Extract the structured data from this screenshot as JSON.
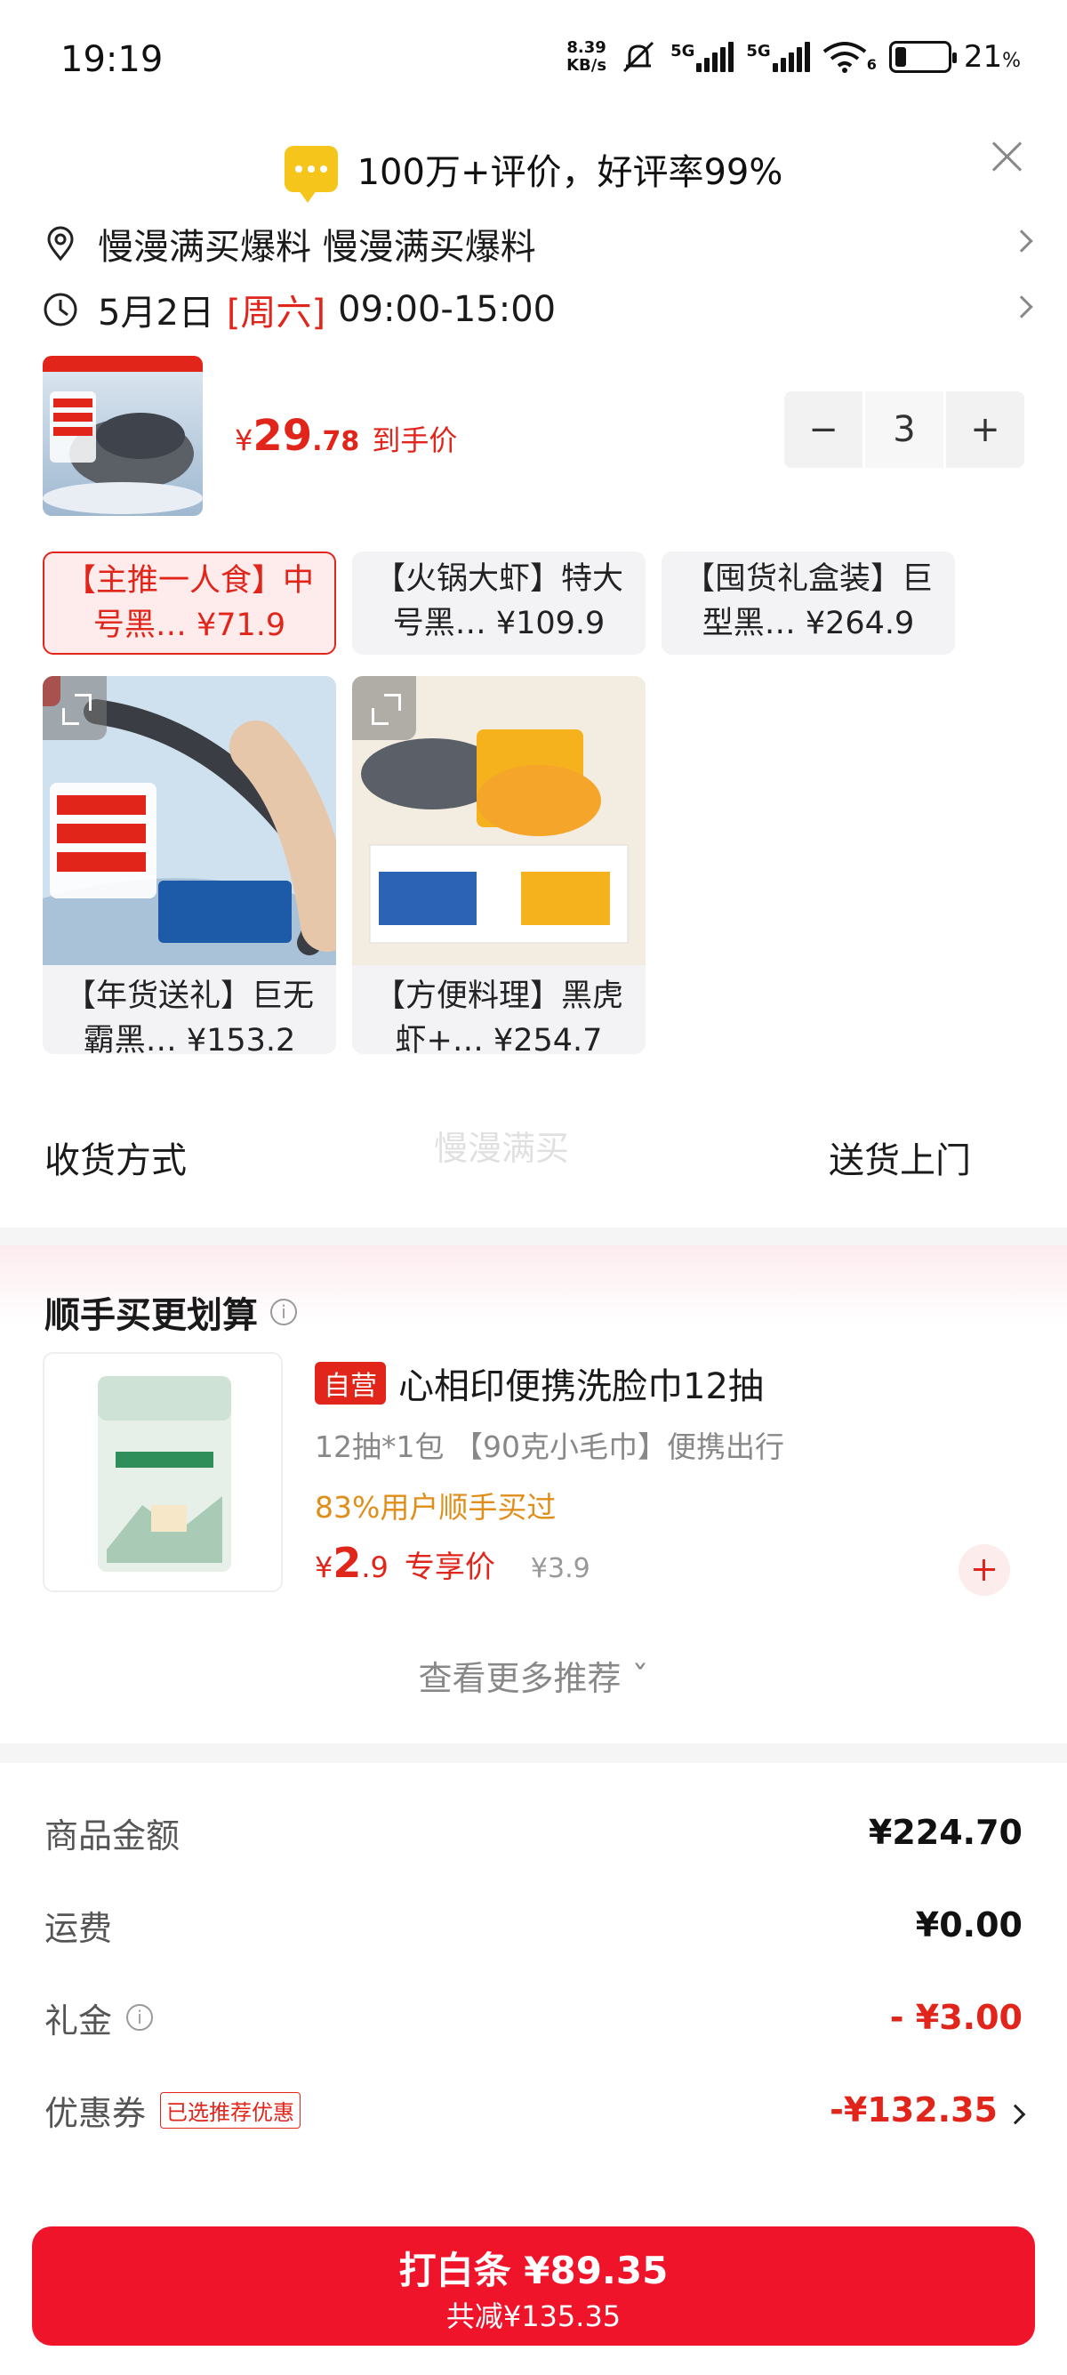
{
  "status_bar": {
    "time": "19:19",
    "net_speed_value": "8.39",
    "net_speed_unit": "KB/s",
    "sig1_label": "5G",
    "sig2_label": "5G",
    "wifi_label": "6",
    "battery_percent": 21,
    "battery_text": "21",
    "battery_unit": "%"
  },
  "banner": {
    "rating_text": "100万+评价，好评率99%"
  },
  "address": {
    "text": "慢漫满买爆料  慢漫满买爆料"
  },
  "delivery_time": {
    "date": "5月2日",
    "weekday": "[周六]",
    "range": "09:00-15:00"
  },
  "product": {
    "price_symbol": "¥",
    "price_int": "29",
    "price_dec": ".78",
    "price_tag": "到手价",
    "qty": "3",
    "minus": "−",
    "plus": "+"
  },
  "variants": {
    "v1_line1": "【主推一人食】中",
    "v1_line2": "号黑… ¥71.9",
    "v2_line1": "【火锅大虾】特大",
    "v2_line2": "号黑… ¥109.9",
    "v3_line1": "【囤货礼盒装】巨",
    "v3_line2": "型黑… ¥264.9",
    "v4_line1": "【年货送礼】巨无",
    "v4_line2": "霸黑… ¥153.2",
    "v5_line1": "【方便料理】黑虎",
    "v5_line2": "虾+… ¥254.7"
  },
  "delivery": {
    "label": "收货方式",
    "value": "送货上门",
    "watermark": "慢漫满买"
  },
  "recommend": {
    "title": "顺手买更划算",
    "badge": "自营",
    "name": "心相印便携洗脸巾12抽",
    "spec": "12抽*1包 【90克小毛巾】便携出行",
    "bought": "83%用户顺手买过",
    "price_symbol": "¥",
    "price_int": "2",
    "price_dec": ".9",
    "price_label": "专享价",
    "orig_price": "¥3.9",
    "see_more": "查看更多推荐 ˇ"
  },
  "summary": {
    "goods_label": "商品金额",
    "goods_value": "¥224.70",
    "shipping_label": "运费",
    "shipping_value": "¥0.00",
    "gift_label": "礼金",
    "gift_value": "- ¥3.00",
    "coupon_label": "优惠券",
    "coupon_tag": "已选推荐优惠",
    "coupon_value": "-¥132.35"
  },
  "pay": {
    "main": "打白条 ¥89.35",
    "sub": "共减¥135.35"
  },
  "colors": {
    "accent": "#e1251b",
    "button": "#f0142a",
    "orange": "#e08e1a"
  }
}
